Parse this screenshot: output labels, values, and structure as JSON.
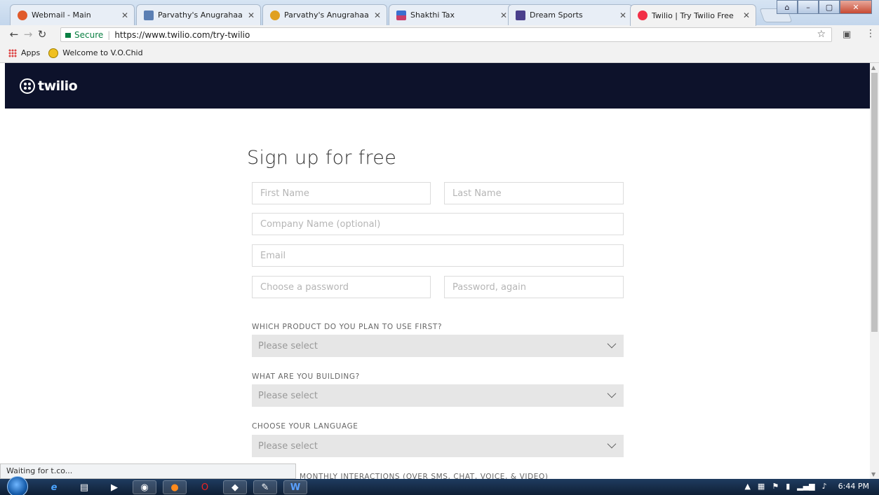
{
  "browser": {
    "tabs": [
      {
        "title": "Webmail - Main",
        "favicon_color": "#e05a2b",
        "active": false
      },
      {
        "title": "Parvathy's Anugrahaa Int",
        "favicon_color": "#5b7fb3",
        "active": false
      },
      {
        "title": "Parvathy's Anugrahaa Int",
        "favicon_color": "#e0a020",
        "active": false
      },
      {
        "title": "Shakthi Tax",
        "favicon_color": "#c83e6a",
        "active": false
      },
      {
        "title": "Dream Sports",
        "favicon_color": "#4a3f8c",
        "active": false
      },
      {
        "title": "Twilio | Try Twilio Free",
        "favicon_color": "#f22f46",
        "active": true
      }
    ],
    "secure_label": "Secure",
    "url": "https://www.twilio.com/try-twilio",
    "bookmarks": {
      "apps_label": "Apps",
      "items": [
        "Welcome to V.O.Chid"
      ]
    },
    "status_text": "Waiting for t.co..."
  },
  "page": {
    "brand": {
      "name": "twilio",
      "bar_color": "#0d122b"
    },
    "heading": "Sign up for free",
    "fields": {
      "first_name": "First Name",
      "last_name": "Last Name",
      "company": "Company Name (optional)",
      "email": "Email",
      "password": "Choose a password",
      "password_again": "Password, again"
    },
    "questions": [
      {
        "label": "WHICH PRODUCT DO YOU PLAN TO USE FIRST?",
        "value": "Please select"
      },
      {
        "label": "WHAT ARE YOU BUILDING?",
        "value": "Please select"
      },
      {
        "label": "CHOOSE YOUR LANGUAGE",
        "value": "Please select"
      }
    ],
    "partial_label": "MONTHLY INTERACTIONS (OVER SMS, CHAT, VOICE, & VIDEO)"
  },
  "taskbar": {
    "clock": "6:44 PM"
  }
}
